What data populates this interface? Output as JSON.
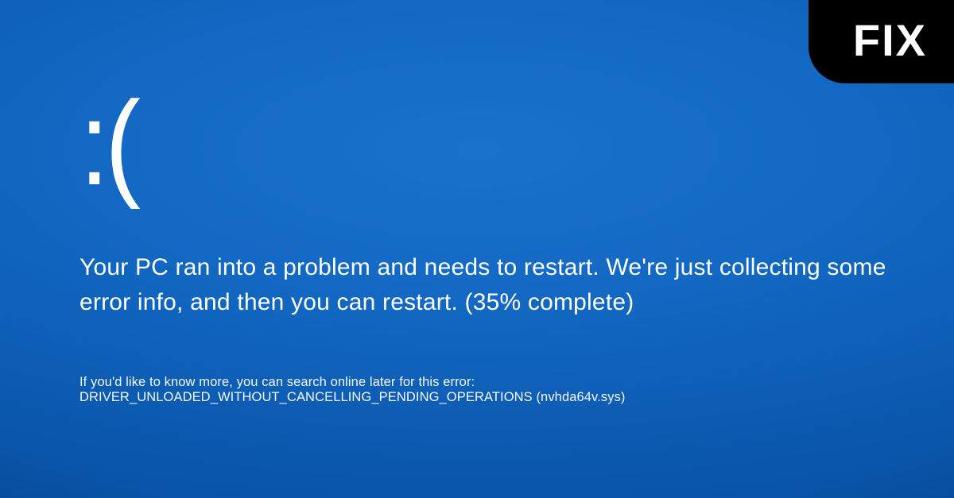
{
  "bsod": {
    "frown": ":(",
    "message": "Your PC ran into a problem and needs to restart. We're just collecting some error info, and then you can restart. (35% complete)",
    "error_detail": "If you'd like to know more, you can search online later for this error: DRIVER_UNLOADED_WITHOUT_CANCELLING_PENDING_OPERATIONS (nvhda64v.sys)"
  },
  "overlay": {
    "fix_label": "FIX"
  }
}
